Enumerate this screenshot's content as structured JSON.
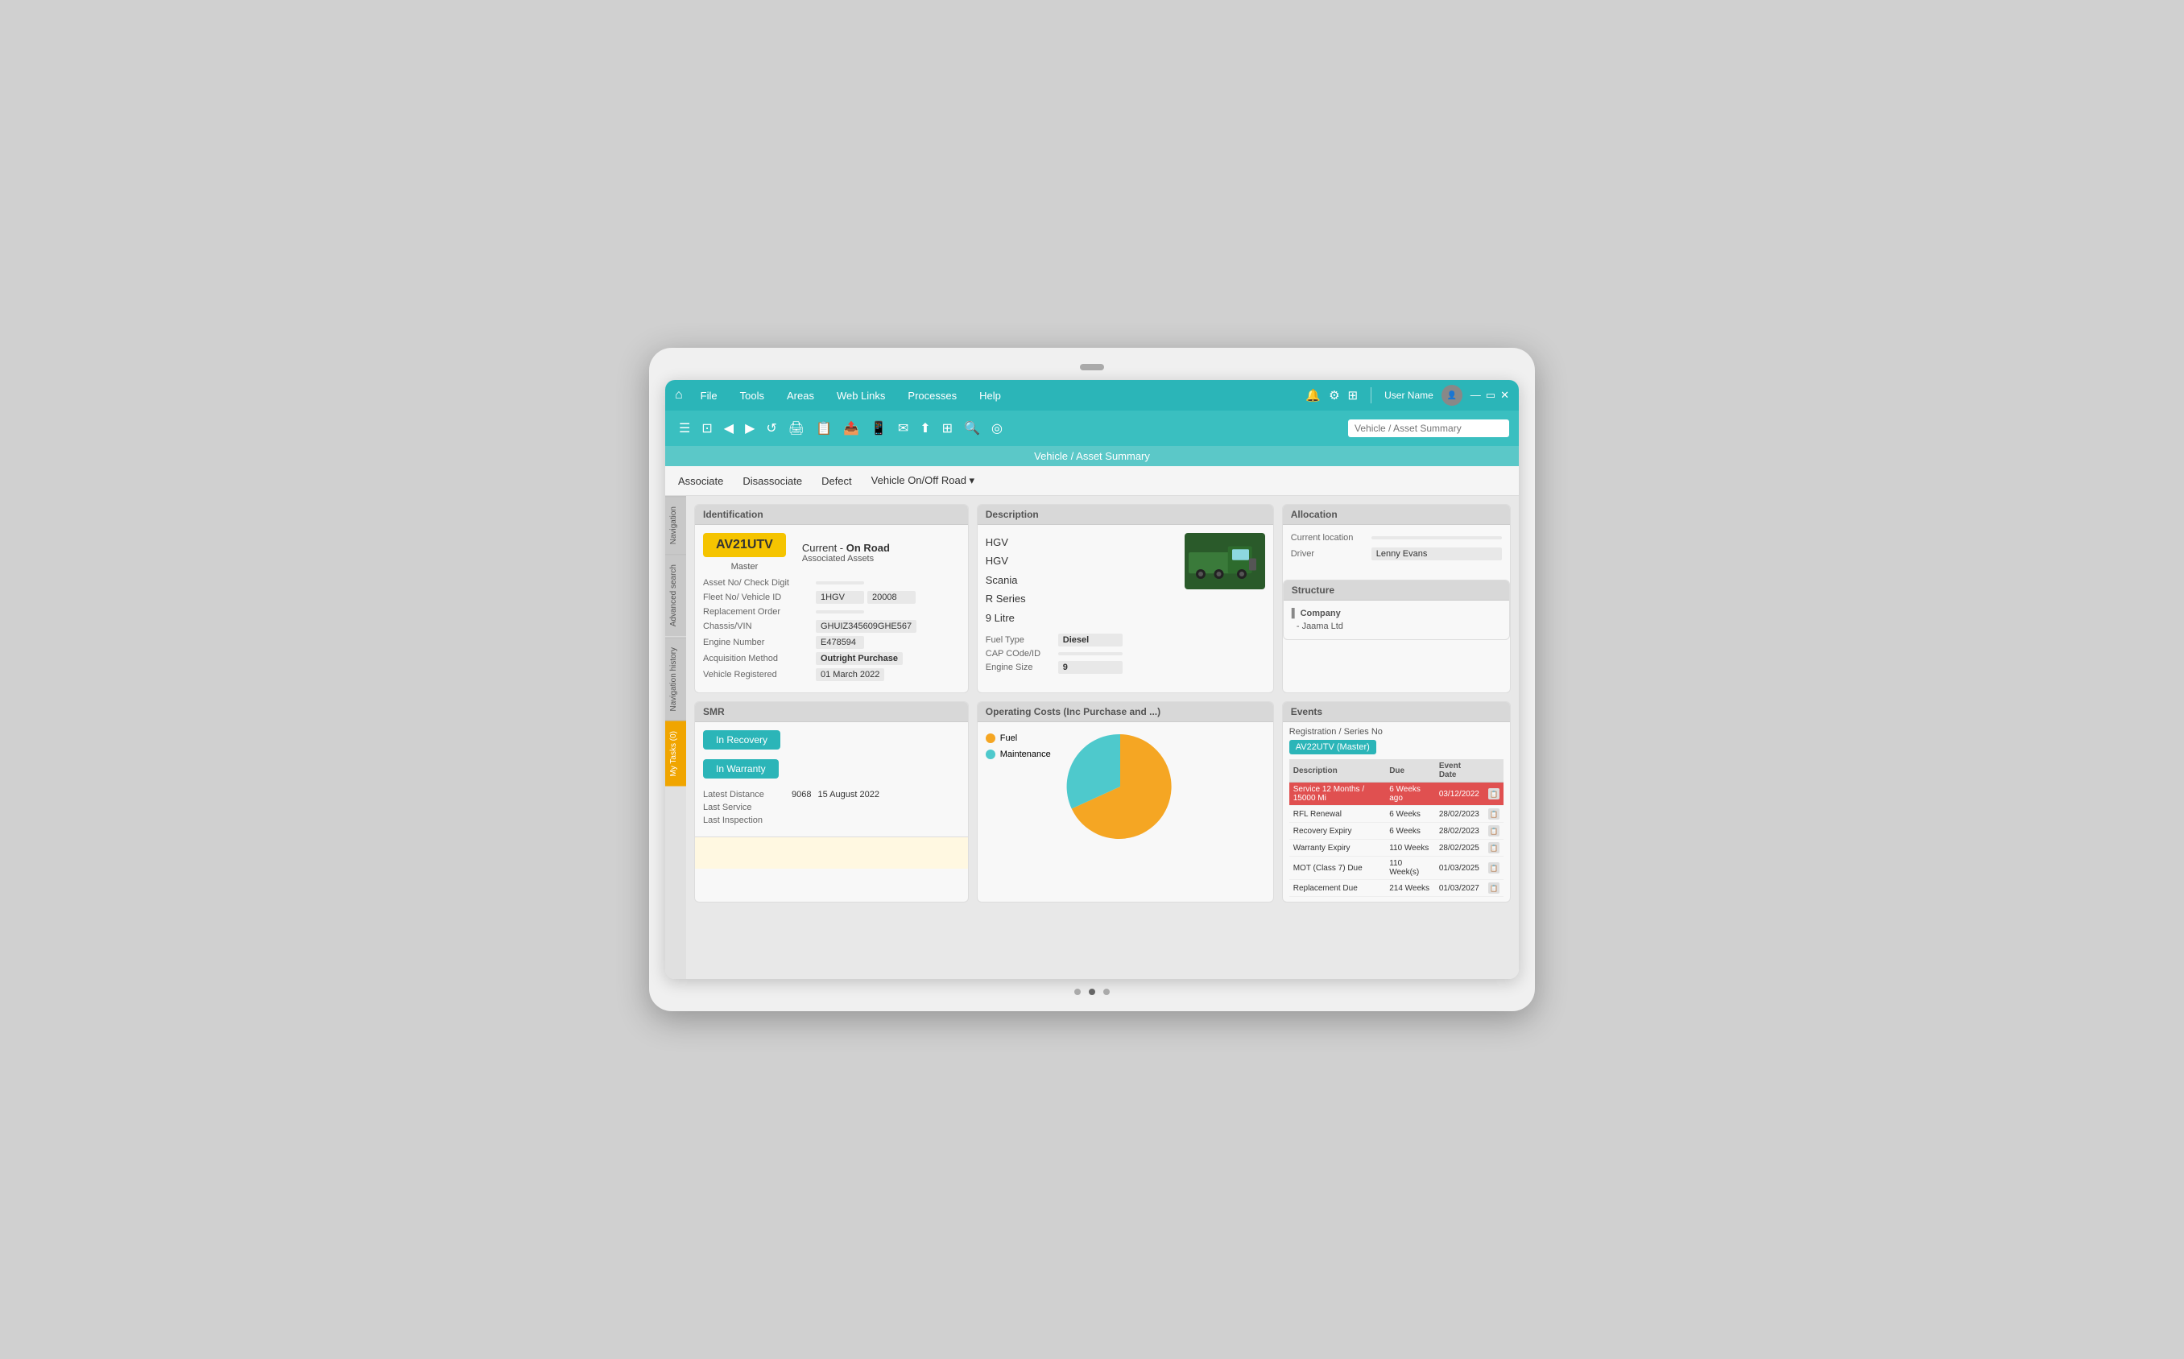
{
  "device": {
    "notch_label": "notch"
  },
  "menu_bar": {
    "home_icon": "⌂",
    "items": [
      {
        "label": "File",
        "id": "file"
      },
      {
        "label": "Tools",
        "id": "tools"
      },
      {
        "label": "Areas",
        "id": "areas"
      },
      {
        "label": "Web Links",
        "id": "web-links"
      },
      {
        "label": "Processes",
        "id": "processes"
      },
      {
        "label": "Help",
        "id": "help"
      }
    ],
    "bell_icon": "🔔",
    "gear_icon": "⚙",
    "grid_icon": "⊞",
    "username": "User Name",
    "minimize": "—",
    "maximize": "▭",
    "close": "✕"
  },
  "toolbar": {
    "icons": [
      "☰",
      "⊡",
      "◀",
      "▶",
      "↺",
      "🖶",
      "📑",
      "📤",
      "📱",
      "✉",
      "📤",
      "⊞",
      "🔍",
      "◎"
    ],
    "search_placeholder": "Vehicle / Asset Summary"
  },
  "page_title": "Vehicle / Asset Summary",
  "action_bar": {
    "items": [
      {
        "label": "Associate",
        "dropdown": false
      },
      {
        "label": "Disassociate",
        "dropdown": false
      },
      {
        "label": "Defect",
        "dropdown": false
      },
      {
        "label": "Vehicle On/Off Road",
        "dropdown": true
      }
    ]
  },
  "side_tabs": [
    {
      "label": "Navigation",
      "id": "navigation"
    },
    {
      "label": "Advanced search",
      "id": "advanced-search"
    },
    {
      "label": "Navigation history",
      "id": "nav-history"
    },
    {
      "label": "My Tasks (0)",
      "id": "my-tasks",
      "highlight": true
    }
  ],
  "identification": {
    "header": "Identification",
    "asset_number": "AV21UTV",
    "status_prefix": "Current - ",
    "status": "On Road",
    "row1_label1": "Master",
    "row1_label2": "Associated Assets",
    "fields": [
      {
        "label": "Asset No/ Check Digit",
        "value": "",
        "value2": ""
      },
      {
        "label": "Fleet No/ Vehicle ID",
        "value": "1HGV",
        "value2": "20008"
      },
      {
        "label": "Replacement Order",
        "value": ""
      },
      {
        "label": "Chassis/VIN",
        "value": "GHUIZ345609GHE567"
      },
      {
        "label": "Engine Number",
        "value": "E478594"
      },
      {
        "label": "Acquisition Method",
        "value": "Outright Purchase"
      },
      {
        "label": "Vehicle Registered",
        "value": "01 March 2022"
      }
    ]
  },
  "description": {
    "header": "Description",
    "type1": "HGV",
    "type2": "HGV",
    "make": "Scania",
    "model": "R Series",
    "variant": "9 Litre",
    "fields": [
      {
        "label": "Fuel Type",
        "value": "Diesel"
      },
      {
        "label": "CAP COde/ID",
        "value": ""
      },
      {
        "label": "Engine Size",
        "value": "9"
      }
    ]
  },
  "allocation": {
    "header": "Allocation",
    "fields": [
      {
        "label": "Current location",
        "value": ""
      },
      {
        "label": "Driver",
        "value": "Lenny Evans"
      }
    ]
  },
  "structure": {
    "header": "Structure",
    "company": "Company",
    "sub": "Jaama Ltd"
  },
  "smr": {
    "header": "SMR",
    "btn_recovery": "In Recovery",
    "btn_warranty": "In Warranty",
    "fields": [
      {
        "label": "Latest Distance",
        "value": "9068",
        "date": "15 August 2022"
      },
      {
        "label": "Last Service",
        "value": "",
        "date": ""
      },
      {
        "label": "Last Inspection",
        "value": "",
        "date": ""
      }
    ]
  },
  "operating_costs": {
    "header": "Operating Costs (Inc Purchase and ...)",
    "legend": [
      {
        "label": "Fuel",
        "color": "#f5a623"
      },
      {
        "label": "Maintenance",
        "color": "#4ec9cc"
      }
    ],
    "pie": {
      "fuel_pct": 60,
      "maint_pct": 40
    }
  },
  "events": {
    "header": "Events",
    "reg_label": "Registration / Series No",
    "master_badge": "AV22UTV (Master)",
    "table_headers": [
      "Description",
      "Due",
      "Event Date",
      ""
    ],
    "rows": [
      {
        "description": "Service 12 Months / 15000 Mi",
        "due": "6 Weeks ago",
        "event_date": "03/12/2022",
        "overdue": true
      },
      {
        "description": "RFL Renewal",
        "due": "6 Weeks",
        "event_date": "28/02/2023",
        "overdue": false
      },
      {
        "description": "Recovery Expiry",
        "due": "6 Weeks",
        "event_date": "28/02/2023",
        "overdue": false
      },
      {
        "description": "Warranty Expiry",
        "due": "110 Weeks",
        "event_date": "28/02/2025",
        "overdue": false
      },
      {
        "description": "MOT (Class 7) Due",
        "due": "110 Week(s)",
        "event_date": "01/03/2025",
        "overdue": false
      },
      {
        "description": "Replacement Due",
        "due": "214 Weeks",
        "event_date": "01/03/2027",
        "overdue": false
      }
    ]
  }
}
